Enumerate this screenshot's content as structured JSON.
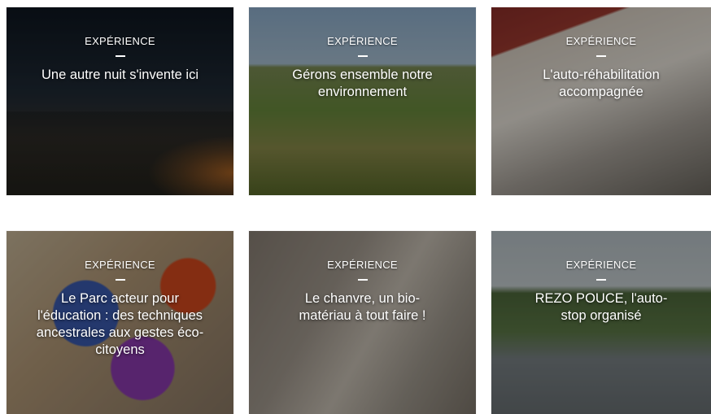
{
  "cards": [
    {
      "tag": "EXPÉRIENCE",
      "title": "Une autre nuit s'invente ici"
    },
    {
      "tag": "EXPÉRIENCE",
      "title": "Gérons ensemble notre environnement"
    },
    {
      "tag": "EXPÉRIENCE",
      "title": "L'auto-réhabilitation accompagnée"
    },
    {
      "tag": "EXPÉRIENCE",
      "title": "Le Parc acteur pour l'éducation : des techniques ancestrales aux gestes éco-citoyens"
    },
    {
      "tag": "EXPÉRIENCE",
      "title": "Le chanvre, un bio-matériau à tout faire !"
    },
    {
      "tag": "EXPÉRIENCE",
      "title": "REZO POUCE, l'auto-stop organisé"
    }
  ]
}
